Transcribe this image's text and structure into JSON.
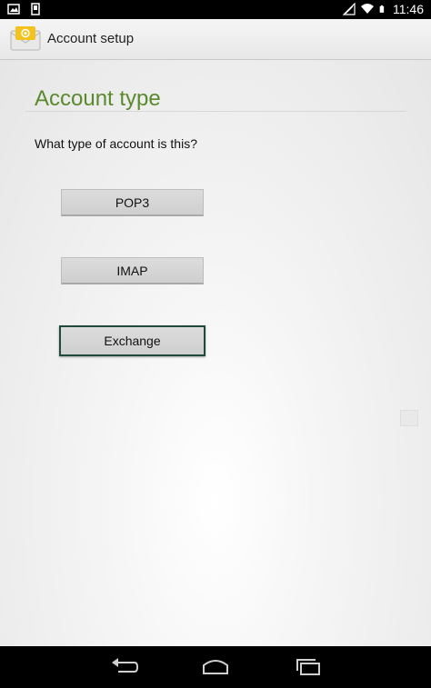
{
  "status_bar": {
    "time": "11:46",
    "icons": [
      "picture-icon",
      "sd-card-icon",
      "wifi-icon",
      "signal-icon",
      "battery-icon"
    ]
  },
  "action_bar": {
    "title": "Account setup",
    "icon": "email-app-icon"
  },
  "main": {
    "section_title": "Account type",
    "question": "What type of account is this?",
    "buttons": [
      {
        "label": "POP3"
      },
      {
        "label": "IMAP"
      },
      {
        "label": "Exchange"
      }
    ]
  },
  "nav_bar": {
    "icons": [
      "back-icon",
      "home-icon",
      "recent-apps-icon"
    ]
  },
  "colors": {
    "accent": "#5a8a2c",
    "focus_border": "#1f4a3c"
  }
}
